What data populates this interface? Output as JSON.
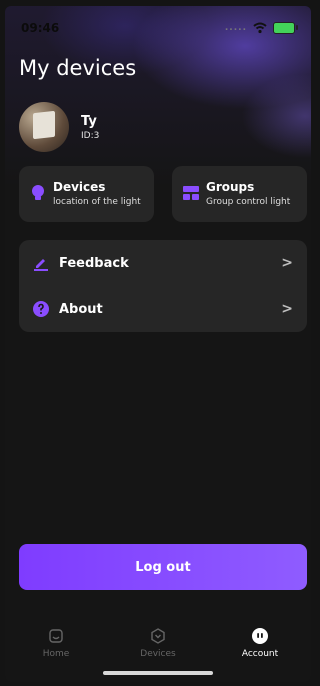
{
  "status_bar": {
    "time": "09:46",
    "carrier_dots": "....."
  },
  "page": {
    "title": "My devices"
  },
  "profile": {
    "name": "Ty",
    "id": "ID:3"
  },
  "cards": [
    {
      "title": "Devices",
      "subtitle": "location of the light",
      "icon": "bulb-icon"
    },
    {
      "title": "Groups",
      "subtitle": "Group control light",
      "icon": "groups-icon"
    }
  ],
  "menu": [
    {
      "label": "Feedback",
      "icon": "pencil-icon",
      "chevron": ">"
    },
    {
      "label": "About",
      "icon": "question-icon",
      "chevron": ">"
    }
  ],
  "logout_label": "Log out",
  "tabs": [
    {
      "label": "Home",
      "icon": "home-icon",
      "active": false
    },
    {
      "label": "Devices",
      "icon": "devices-icon",
      "active": false
    },
    {
      "label": "Account",
      "icon": "account-icon",
      "active": true
    }
  ],
  "colors": {
    "accent": "#8249ff",
    "card_bg": "#262626",
    "background": "#151515"
  }
}
